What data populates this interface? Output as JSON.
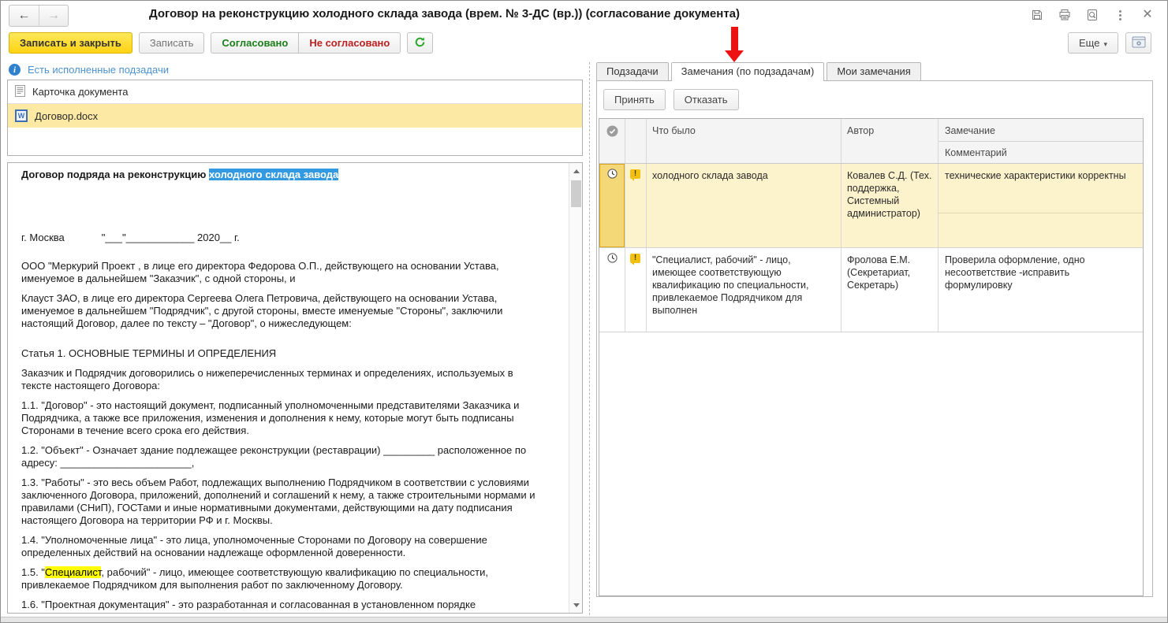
{
  "window": {
    "title": "Договор на реконструкцию холодного склада завода (врем. № 3-ДС (вр.)) (согласование документа)"
  },
  "toolbar": {
    "save_close": "Записать и закрыть",
    "save": "Записать",
    "approved": "Согласовано",
    "not_approved": "Не согласовано",
    "more": "Еще"
  },
  "left": {
    "notice": "Есть исполненные подзадачи",
    "files": [
      {
        "name": "Карточка документа",
        "icon": "document-card-icon",
        "selected": false
      },
      {
        "name": "Договор.docx",
        "icon": "word-file-icon",
        "selected": true
      }
    ],
    "document": {
      "paragraphs": [
        {
          "cls": "t",
          "segs": [
            [
              "n",
              "Договор подряда на реконструкцию "
            ],
            [
              "sel",
              "холодного склада завода"
            ]
          ]
        },
        {
          "cls": "d",
          "segs": [
            [
              "n",
              "г. Москва             \"___\"____________ 2020__ г."
            ]
          ]
        },
        {
          "cls": "",
          "segs": [
            [
              "n",
              "ООО \"Меркурий Проект , в лице его директора Федорова О.П., действующего на основании Устава, именуемое в дальнейшем \"Заказчик\", с одной стороны, и"
            ]
          ]
        },
        {
          "cls": "",
          "segs": [
            [
              "n",
              "Клауст ЗАО, в лице его директора Сергеева Олега Петровича, действующего на основании Устава, именуемое в дальнейшем \"Подрядчик\", с другой стороны, вместе именуемые \"Стороны\", заключили настоящий Договор,  далее по тексту – \"Договор\",  о нижеследующем:"
            ]
          ]
        },
        {
          "cls": "h",
          "segs": [
            [
              "n",
              "Статья 1. ОСНОВНЫЕ ТЕРМИНЫ И ОПРЕДЕЛЕНИЯ"
            ]
          ]
        },
        {
          "cls": "",
          "segs": [
            [
              "n",
              "Заказчик и Подрядчик договорились о нижеперечисленных терминах и определениях, используемых в тексте настоящего Договора:"
            ]
          ]
        },
        {
          "cls": "",
          "segs": [
            [
              "n",
              "1.1. \"Договор\" - это настоящий документ, подписанный уполномоченными представителями Заказчика и Подрядчика, а также все приложения, изменения и дополнения к нему, которые могут быть подписаны Сторонами в течение всего срока его действия."
            ]
          ]
        },
        {
          "cls": "",
          "segs": [
            [
              "n",
              "1.2. \"Объект\" - Означает здание подлежащее реконструкции (реставрации) _________ расположенное по адресу: _______________________,"
            ]
          ]
        },
        {
          "cls": "",
          "segs": [
            [
              "n",
              "1.3. \"Работы\" - это весь объем Работ, подлежащих выполнению Подрядчиком в соответствии с условиями заключенного Договора, приложений, дополнений и соглашений к нему, а также строительными нормами и правилами (СНиП), ГОСТами и иные нормативными документами, действующими на дату подписания настоящего Договора на территории РФ и г. Москвы."
            ]
          ]
        },
        {
          "cls": "",
          "segs": [
            [
              "n",
              "1.4. \"Уполномоченные лица\" - это лица, уполномоченные Сторонами по Договору на совершение определенных действий на основании надлежаще оформленной доверенности."
            ]
          ]
        },
        {
          "cls": "",
          "segs": [
            [
              "n",
              "1.5. \""
            ],
            [
              "hl",
              "Специалист"
            ],
            [
              "n",
              ", рабочий\" - лицо, имеющее соответствующую квалификацию по специальности, привлекаемое Подрядчиком для выполнения работ по заключенному Договору."
            ]
          ]
        },
        {
          "cls": "",
          "segs": [
            [
              "n",
              "1.6. \"Проектная документация\" - это разработанная и согласованная в установленном порядке"
            ]
          ]
        }
      ]
    }
  },
  "right": {
    "tabs": [
      {
        "label": "Подзадачи",
        "active": false
      },
      {
        "label": "Замечания (по подзадачам)",
        "active": true
      },
      {
        "label": "Мои замечания",
        "active": false
      }
    ],
    "accept": "Принять",
    "reject": "Отказать",
    "table": {
      "headers": {
        "what": "Что было",
        "author": "Автор",
        "remark": "Замечание",
        "comment": "Комментарий"
      },
      "rows": [
        {
          "selected": true,
          "what": "холодного склада завода",
          "author": "Ковалев С.Д. (Тех. поддержка, Системный администратор)",
          "remark": "технические характеристики корректны",
          "comment": ""
        },
        {
          "selected": false,
          "what": "\"Специалист, рабочий\" - лицо, имеющее соответствующую квалификацию по специальности, привлекаемое Подрядчиком для выполнен",
          "author": "Фролова Е.М. (Секретариат, Секретарь)",
          "remark": "Проверила оформление, одно несоответствие -исправить формулировку",
          "comment": ""
        }
      ]
    }
  },
  "colors": {
    "accent_yellow_button": "#ffd313",
    "approved_green": "#1b7e1b",
    "not_approved_red": "#bc2020",
    "link_blue": "#4c92cc",
    "selection_blue": "#3399e0",
    "text_highlight_yellow": "#ffff00",
    "selected_row_yellow": "#fcf2cc",
    "selected_cell_gold": "#f4d877",
    "annotation_arrow_red": "#ee1111",
    "warning_icon_yellow": "#f2c011"
  }
}
